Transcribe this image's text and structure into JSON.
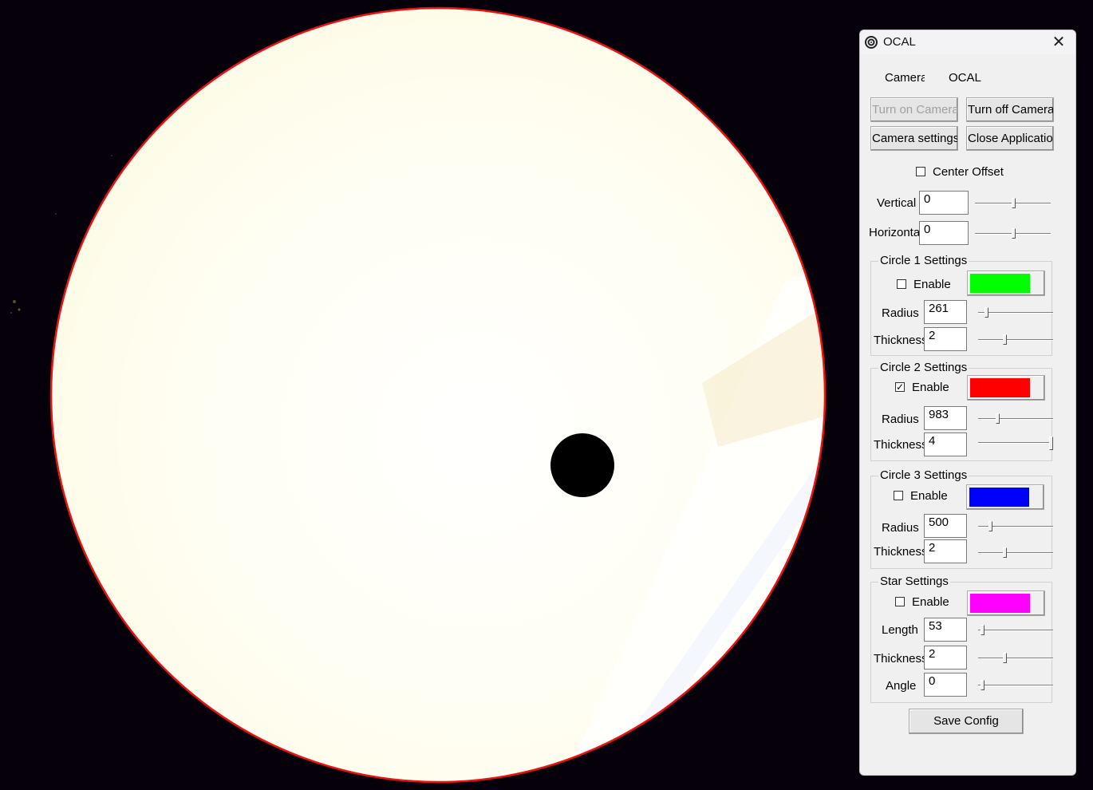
{
  "window": {
    "title": "OCAL",
    "close_glyph": "✕"
  },
  "header": {
    "camera_label": "Camera",
    "camera_value": "OCAL"
  },
  "buttons": {
    "turn_on": "Turn on Camera",
    "turn_off": "Turn off Camera",
    "settings": "Camera settings",
    "close_app": "Close Application",
    "save": "Save Config"
  },
  "center_offset": {
    "label": "Center Offset",
    "checked": false,
    "vertical_label": "Vertical",
    "vertical_value": "0",
    "horizontal_label": "Horizontal",
    "horizontal_value": "0"
  },
  "circles": [
    {
      "title": "Circle 1 Settings",
      "enable_label": "Enable",
      "enabled": false,
      "color": "#00ff00",
      "radius_label": "Radius",
      "radius": "261",
      "thickness_label": "Thickness",
      "thickness": "2"
    },
    {
      "title": "Circle 2 Settings",
      "enable_label": "Enable",
      "enabled": true,
      "color": "#ff0000",
      "radius_label": "Radius",
      "radius": "983",
      "thickness_label": "Thickness",
      "thickness": "4"
    },
    {
      "title": "Circle 3 Settings",
      "enable_label": "Enable",
      "enabled": false,
      "color": "#0000ff",
      "radius_label": "Radius",
      "radius": "500",
      "thickness_label": "Thickness",
      "thickness": "2"
    }
  ],
  "star": {
    "title": "Star Settings",
    "enable_label": "Enable",
    "enabled": false,
    "color": "#ff00ff",
    "length_label": "Length",
    "length": "53",
    "thickness_label": "Thickness",
    "thickness": "2",
    "angle_label": "Angle",
    "angle": "0"
  },
  "check_glyph": "✓",
  "colors": {
    "overlay_circle": "#ff0000",
    "panel_bg": "#f0f0f0",
    "bright_disc": "#fffdee"
  },
  "icons": {
    "app": "ocal-target-icon",
    "close": "close-icon"
  }
}
